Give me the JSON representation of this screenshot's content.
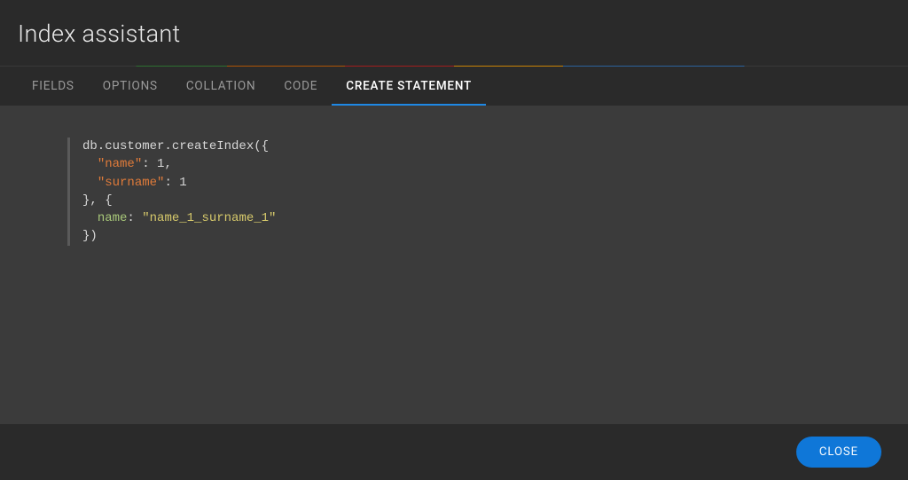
{
  "header": {
    "title": "Index assistant"
  },
  "tabs": [
    {
      "label": "FIELDS",
      "active": false
    },
    {
      "label": "OPTIONS",
      "active": false
    },
    {
      "label": "COLLATION",
      "active": false
    },
    {
      "label": "CODE",
      "active": false
    },
    {
      "label": "CREATE STATEMENT",
      "active": true
    }
  ],
  "code": {
    "prefix": "db.customer.createIndex",
    "open_args": "({",
    "fields": [
      {
        "key": "\"name\"",
        "value": "1",
        "trailing_comma": true
      },
      {
        "key": "\"surname\"",
        "value": "1",
        "trailing_comma": false
      }
    ],
    "mid": "}, {",
    "option_ident": "name",
    "option_sep": ": ",
    "option_value": "\"name_1_surname_1\"",
    "close": "})"
  },
  "footer": {
    "close_label": "CLOSE"
  }
}
